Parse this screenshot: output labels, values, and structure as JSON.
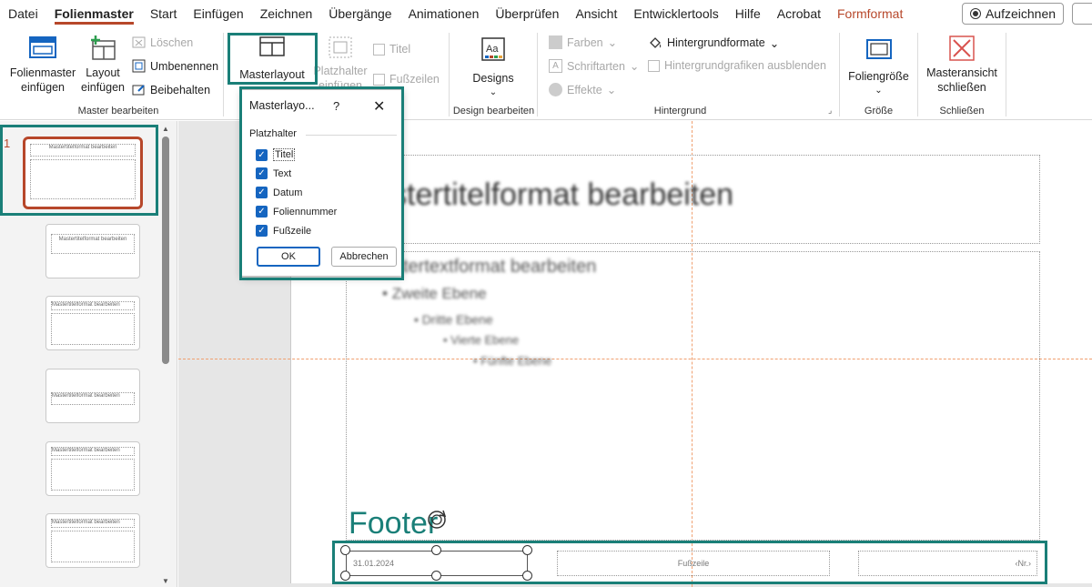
{
  "menu": {
    "tabs": [
      "Datei",
      "Folienmaster",
      "Start",
      "Einfügen",
      "Zeichnen",
      "Übergänge",
      "Animationen",
      "Überprüfen",
      "Ansicht",
      "Entwicklertools",
      "Hilfe",
      "Acrobat",
      "Formformat"
    ],
    "active_tab": "Folienmaster",
    "record_label": "Aufzeichnen"
  },
  "ribbon": {
    "groups": {
      "master_edit": {
        "label": "Master bearbeiten",
        "insert_master": "Folienmaster einfügen",
        "insert_layout": "Layout einfügen",
        "delete": "Löschen",
        "rename": "Umbenennen",
        "preserve": "Beibehalten"
      },
      "master_layout": {
        "master_layout": "Masterlayout",
        "insert_placeholder": "Platzhalter einfügen",
        "title": "Titel",
        "footers": "Fußzeilen"
      },
      "design_edit": {
        "label": "Design bearbeiten",
        "designs": "Designs"
      },
      "background": {
        "label": "Hintergrund",
        "colors": "Farben",
        "fonts": "Schriftarten",
        "effects": "Effekte",
        "bg_styles": "Hintergrundformate",
        "hide_bg": "Hintergrundgrafiken ausblenden"
      },
      "size": {
        "label": "Größe",
        "slide_size": "Foliengröße"
      },
      "close": {
        "label": "Schließen",
        "close_master": "Masteransicht schließen"
      }
    }
  },
  "slide_panel": {
    "selected_number": "1",
    "thumbs": [
      "Mastertitelformat bearbeiten",
      "Mastertitelformat bearbeiten",
      "Mastertitelformat bearbeiten",
      "Mastertitelformat bearbeiten",
      "Mastertitelformat bearbeiten",
      "Mastertitelformat bearbeiten"
    ]
  },
  "slide": {
    "title": "stertitelformat bearbeiten",
    "body": {
      "level1": "stertextformat bearbeiten",
      "level2": "Zweite Ebene",
      "level3": "Dritte Ebene",
      "level4": "Vierte Ebene",
      "level5": "Fünfte Ebene"
    },
    "footer_annotation": "Footer",
    "date": "31.01.2024",
    "footer": "Fußzeile",
    "number": "‹Nr.›"
  },
  "dialog": {
    "title": "Masterlayo...",
    "help": "?",
    "group_label": "Platzhalter",
    "options": [
      "Titel",
      "Text",
      "Datum",
      "Foliennummer",
      "Fußzeile"
    ],
    "ok": "OK",
    "cancel": "Abbrechen"
  },
  "colors": {
    "accent": "#b7472a",
    "highlight": "#1a7f78",
    "checkbox": "#1565c0"
  }
}
